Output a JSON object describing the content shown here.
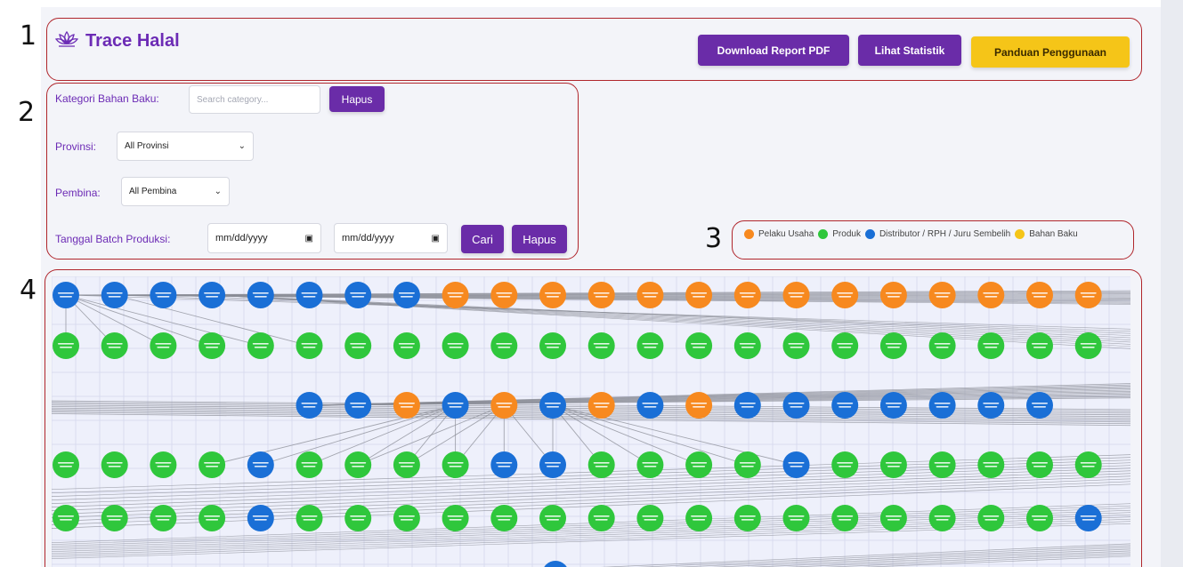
{
  "header": {
    "app_title": "Trace Halal",
    "logo_icon": "lotus-icon",
    "buttons": {
      "download_pdf": "Download Report PDF",
      "statistics": "Lihat Statistik",
      "guide": "Panduan Penggunaan"
    }
  },
  "filters": {
    "category_label": "Kategori Bahan Baku:",
    "category_placeholder": "Search category...",
    "category_clear": "Hapus",
    "province_label": "Provinsi:",
    "province_value": "All Provinsi",
    "pembina_label": "Pembina:",
    "pembina_value": "All Pembina",
    "batch_date_label": "Tanggal Batch Produksi:",
    "date_start": "mm/dd/yyyy",
    "date_end": "mm/dd/yyyy",
    "search_button": "Cari",
    "clear_button": "Hapus"
  },
  "legend": [
    {
      "label": "Pelaku Usaha",
      "color": "#f7891f"
    },
    {
      "label": "Produk",
      "color": "#2fc73c"
    },
    {
      "label": "Distributor / RPH / Juru Sembelih",
      "color": "#1a6fd6"
    },
    {
      "label": "Bahan Baku",
      "color": "#f5c518"
    }
  ],
  "callouts": [
    "1",
    "2",
    "3",
    "4"
  ],
  "graph": {
    "node_colors": {
      "pelaku_usaha": "#f7891f",
      "produk": "#2fc73c",
      "distributor": "#1a6fd6"
    },
    "rows": [
      "BBBBBBBBOOOOOOOOOOOOOO",
      "GGGGGGGGGGGGGGGGGGGGGG",
      "BBOBOBOBOBBBBBBB",
      "GGGGBGGGGBBGGGGBGGGGGG",
      "GGGGBGGGGGGGGGGGGGGGGB"
    ]
  }
}
